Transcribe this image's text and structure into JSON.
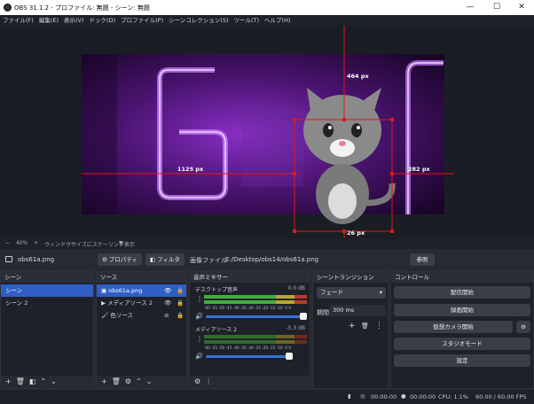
{
  "titlebar": {
    "title": "OBS 31.1.2 - プロファイル: 無題 - シーン: 無題",
    "minimize": "—",
    "maximize": "☐",
    "close": "✕"
  },
  "menu": [
    "ファイル(F)",
    "編集(E)",
    "表示(V)",
    "ドック(D)",
    "プロファイル(P)",
    "シーンコレクション(S)",
    "ツール(T)",
    "ヘルプ(H)"
  ],
  "preview": {
    "top_label": "464 px",
    "left_label": "1125 px",
    "right_label": "282 px",
    "bottom_label": "26 px"
  },
  "statusline": {
    "zoom_minus": "−",
    "zoom": "40%",
    "zoom_plus": "+",
    "scale_text": "ウィンドウサイズにスケーリング表示",
    "dropdown": "▼"
  },
  "sourcebar": {
    "source_name": "obs61a.png",
    "properties": "プロパティ",
    "filters": "フィルタ",
    "file_label": "画像ファイル",
    "file_path": "E:/Desktop/obs14/obs61a.png",
    "browse": "参照"
  },
  "scenes": {
    "title": "シーン",
    "items": [
      "シーン",
      "シーン 2"
    ],
    "selected": 0
  },
  "sources": {
    "title": "ソース",
    "items": [
      {
        "name": "obs61a.png",
        "icon": "image-icon"
      },
      {
        "name": "メディアソース 2",
        "icon": "play-icon"
      },
      {
        "name": "色ソース",
        "icon": "brush-icon"
      }
    ]
  },
  "mixer": {
    "title": "音声ミキサー",
    "channels": [
      {
        "name": "デスクトップ音声",
        "db": "0.0 dB",
        "volume": 1.0
      },
      {
        "name": "メディアソース 2",
        "db": "-5.3 dB",
        "volume": 0.85
      }
    ],
    "scale": "-60 -55 -50 -45 -40 -35 -30 -25 -20 -15 -10 -5 0"
  },
  "transitions": {
    "title": "シーントランジション",
    "type": "フェード",
    "duration_label": "期間",
    "duration": "300 ms"
  },
  "controls": {
    "title": "コントロール",
    "buttons": [
      "配信開始",
      "録画開始",
      "仮想カメラ開始",
      "スタジオモード",
      "設定"
    ]
  },
  "statusbar": {
    "rec_time": "00:00:00",
    "stream_time": "00:00:00",
    "cpu": "CPU: 1.1%",
    "fps": "60.00 / 60.00 FPS"
  },
  "colors": {
    "accent": "#2f5ec4",
    "guide": "#e01818",
    "meter_green": "#3fae3f",
    "meter_yellow": "#b8a82a",
    "meter_red": "#b83a2a"
  }
}
